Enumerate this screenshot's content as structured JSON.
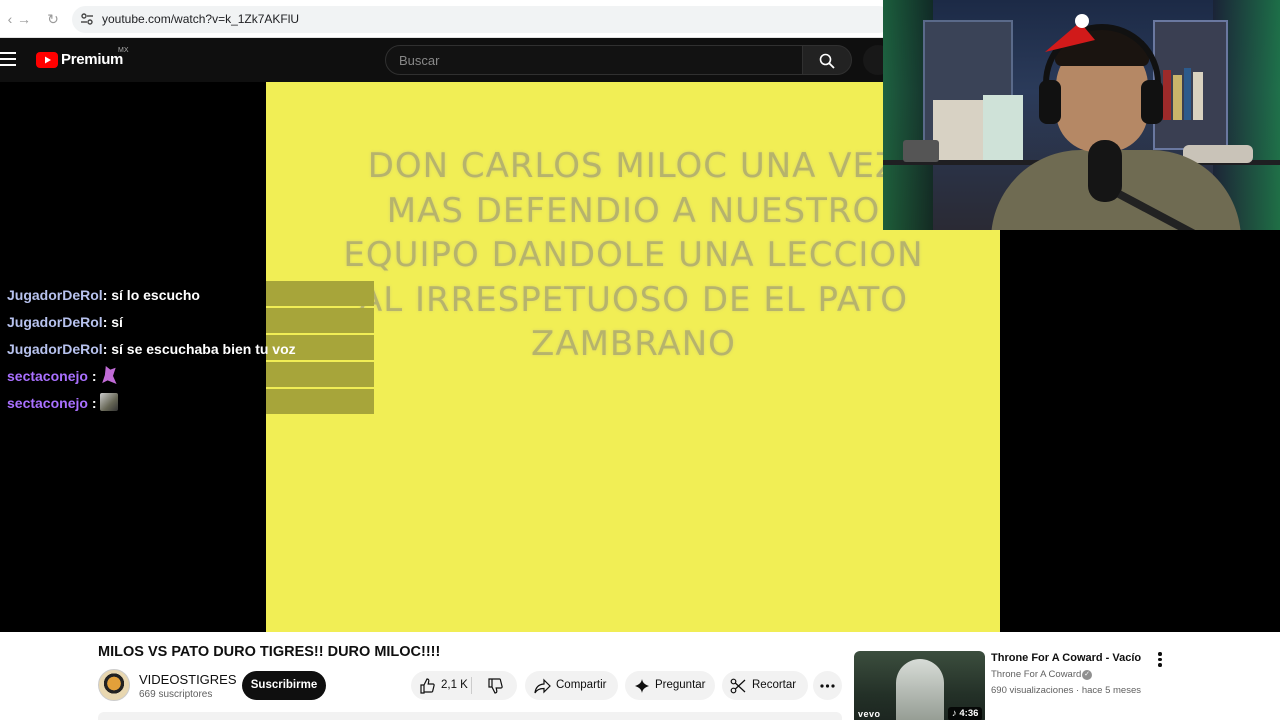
{
  "browser": {
    "url": "youtube.com/watch?v=k_1Zk7AKFlU"
  },
  "header": {
    "logo_text": "Premium",
    "logo_region": "MX",
    "search_placeholder": "Buscar"
  },
  "video": {
    "overlay_text": "DON CARLOS MILOC UNA VEZ MAS DEFENDIO A NUESTRO EQUIPO DANDOLE UNA LECCION AL IRRESPETUOSO DE EL PATO ZAMBRANO",
    "background_color": "#f1ee55"
  },
  "chat": {
    "messages": [
      {
        "user": "JugadorDeRol",
        "text": ": sí lo escucho"
      },
      {
        "user": "JugadorDeRol",
        "text": ": sí"
      },
      {
        "user": "JugadorDeRol",
        "text": ": sí se escuchaba bien tu voz"
      },
      {
        "user": "sectaconejo",
        "text": " : ",
        "emote": "bunny"
      },
      {
        "user": "sectaconejo",
        "text": " : ",
        "emote": "picture"
      }
    ]
  },
  "info": {
    "title": "MILOS VS PATO DURO TIGRES!! DURO MILOC!!!!",
    "channel_name": "VIDEOSTIGRES",
    "subscribers": "669 suscriptores",
    "subscribe_label": "Suscribirme",
    "like_count": "2,1 K",
    "share_label": "Compartir",
    "ask_label": "Preguntar",
    "clip_label": "Recortar"
  },
  "recommendation": {
    "title": "Throne For A Coward - Vacío",
    "channel": "Throne For A Coward",
    "views": "690 visualizaciones",
    "age": "hace 5 meses",
    "duration": "4:36",
    "vevo": "vevo"
  }
}
